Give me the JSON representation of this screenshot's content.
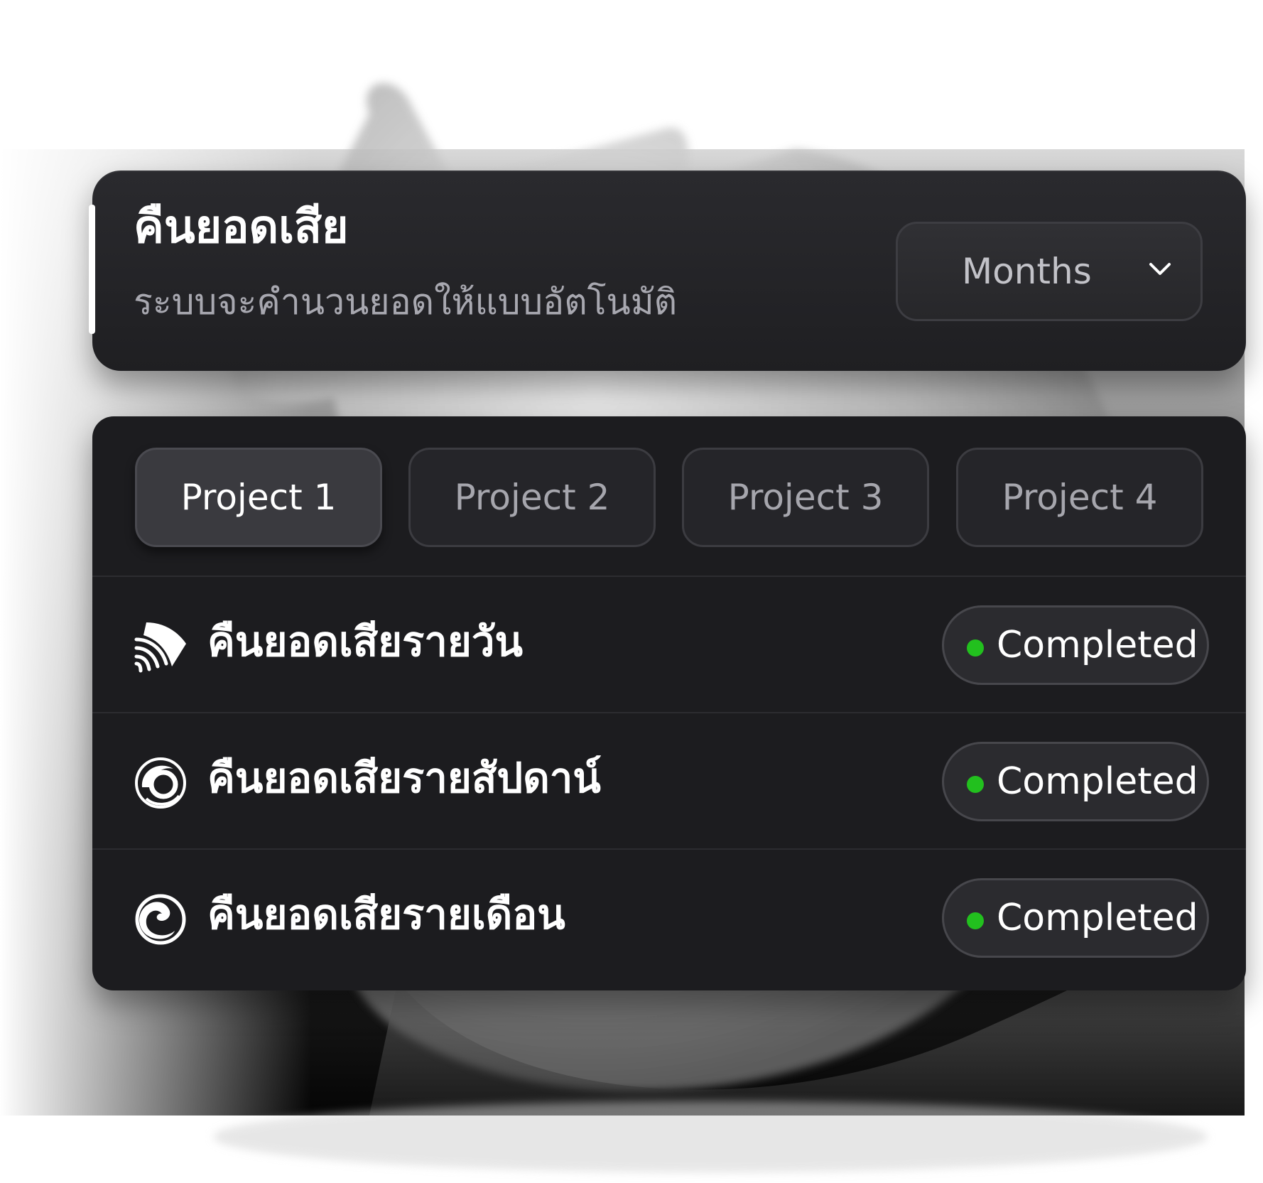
{
  "header": {
    "title": "คืนยอดเสีย",
    "subtitle": "ระบบจะคำนวนยอดให้แบบอัตโนมัติ",
    "period_select": {
      "value": "Months"
    }
  },
  "tabs": [
    {
      "label": "Project 1",
      "active": true
    },
    {
      "label": "Project 2",
      "active": false
    },
    {
      "label": "Project 3",
      "active": false
    },
    {
      "label": "Project 4",
      "active": false
    }
  ],
  "rows": [
    {
      "label": "คืนยอดเสียรายวัน",
      "icon": "layered-fan-icon",
      "status": "Completed"
    },
    {
      "label": "คืนยอดเสียรายสัปดาน์",
      "icon": "swirl-circle-icon",
      "status": "Completed"
    },
    {
      "label": "คืนยอดเสียรายเดือน",
      "icon": "wave-circle-icon",
      "status": "Completed"
    }
  ],
  "colors": {
    "status_completed": "#22c01e",
    "card_background": "#1c1c1f",
    "accent": "#ffffff"
  }
}
